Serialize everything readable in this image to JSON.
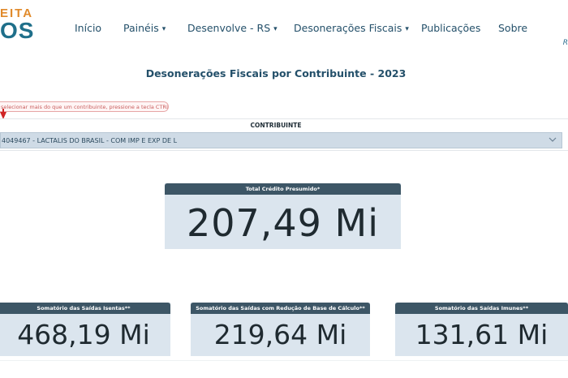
{
  "brand": {
    "line1": "EITA",
    "line2": "OS"
  },
  "nav": {
    "items": [
      {
        "label": "Início",
        "has_menu": false
      },
      {
        "label": "Painéis",
        "has_menu": true
      },
      {
        "label": "Desenvolve - RS",
        "has_menu": true
      },
      {
        "label": "Desonerações Fiscais",
        "has_menu": true
      },
      {
        "label": "Publicações",
        "has_menu": false
      },
      {
        "label": "Sobre",
        "has_menu": false
      }
    ],
    "caret": "▾",
    "edge_fragment": "R"
  },
  "page": {
    "title": "Desonerações Fiscais por Contribuinte - 2023"
  },
  "hint": {
    "text": "selecionar mais do que um contribuinte, pressione a tecla CTRL"
  },
  "contribuinte": {
    "label": "CONTRIBUINTE",
    "value": "4049467 - LACTALIS DO BRASIL - COM IMP E EXP DE L"
  },
  "kpis": {
    "total": {
      "title": "Total Crédito Presumido*",
      "value": "207,49 Mi"
    },
    "isentas": {
      "title": "Somatório das Saídas Isentas**",
      "value": "468,19 Mi"
    },
    "reducao": {
      "title": "Somatório das Saídas com Redução de Base de Cálculo**",
      "value": "219,64 Mi"
    },
    "imunes": {
      "title": "Somatório das Saídas Imunes**",
      "value": "131,61 Mi"
    }
  },
  "colors": {
    "accent": "#1f6f8a",
    "brand_orange": "#e08a2b",
    "card_bg": "#dbe5ee",
    "card_head": "#3d5666",
    "select_bg": "#cfdbe6",
    "hint_red": "#d02525"
  }
}
